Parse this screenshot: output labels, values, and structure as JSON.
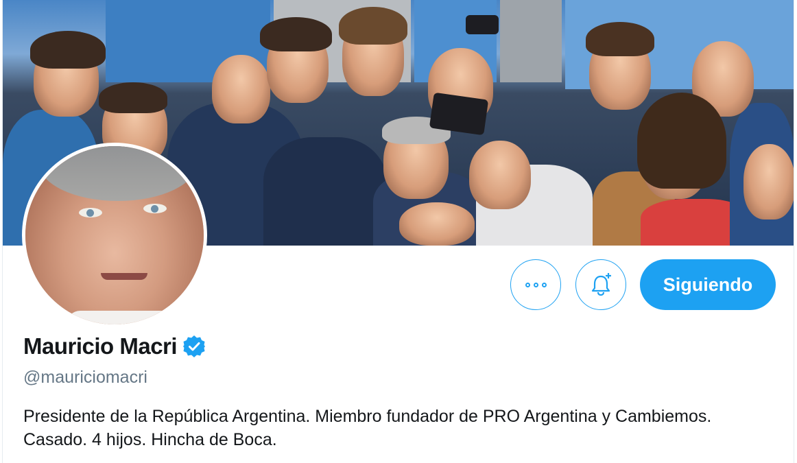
{
  "profile": {
    "name": "Mauricio Macri",
    "handle": "@mauriciomacri",
    "bio": "Presidente de la República Argentina. Miembro fundador de PRO Argentina y Cambiemos. Casado. 4 hijos. Hincha de Boca.",
    "verified": true
  },
  "actions": {
    "more_icon": "more-options-icon",
    "notify_icon": "bell-plus-icon",
    "follow_label": "Siguiendo"
  },
  "colors": {
    "accent": "#1da1f2",
    "text_primary": "#14171a",
    "text_secondary": "#657786"
  }
}
